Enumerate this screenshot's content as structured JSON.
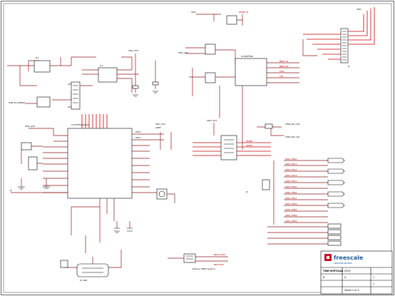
{
  "title_block": {
    "brand": "freescale",
    "sub": "semiconductor",
    "title": "TWR-MCF51AG",
    "doc_no": "0950",
    "size": "B",
    "sheet": "1",
    "of": "1",
    "rev": "A",
    "drawn": "Sheet 1 of 3"
  },
  "notes": {
    "bottom_note": "Debug / BDM Section"
  },
  "net_labels_right": [
    "GPIO_PTA0",
    "GPIO_PTA1",
    "GPIO_PTA2",
    "GPIO_PTA3",
    "GPIO_PTA4",
    "GPIO_PTA5",
    "GPIO_PTA6",
    "GPIO_PTA7",
    "GPIO_PTB0",
    "GPIO_PTB1",
    "GPIO_PTB2",
    "GPIO_PTB3"
  ],
  "connector_labels": [
    "J2",
    "J3",
    "J5",
    "J6",
    "J7",
    "J8"
  ],
  "colors": {
    "wire": "#8b1a1a",
    "bus": "#cc0000",
    "brand": "#1f5ba0",
    "logo_accent": "#c8102e"
  }
}
